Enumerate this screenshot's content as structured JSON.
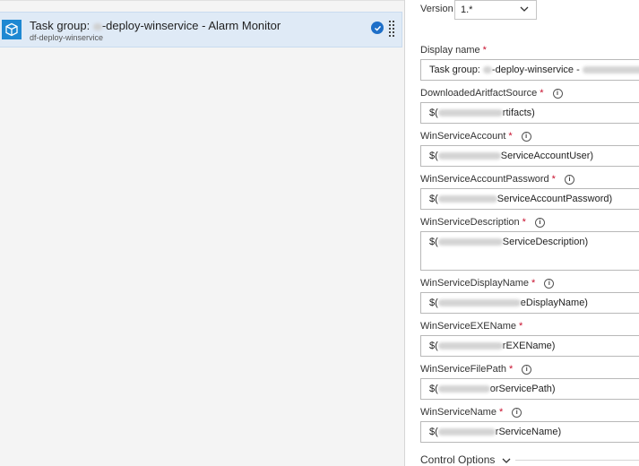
{
  "task_list": {
    "item": {
      "title_prefix": "Task group: ",
      "title_suffix": "-deploy-winservice - Alarm Monitor",
      "subtitle": "df-deploy-winservice"
    }
  },
  "properties": {
    "version_label": "Version",
    "version_value": "1.*",
    "fields": [
      {
        "label": "Display name",
        "required": true,
        "info": false,
        "prefix": "Task group: ",
        "suffix": "-deploy-winservice - "
      },
      {
        "label": "DownloadedAritfactSource",
        "required": true,
        "info": true,
        "prefix": "$(",
        "suffix": "rtifacts)"
      },
      {
        "label": "WinServiceAccount",
        "required": true,
        "info": true,
        "prefix": "$(",
        "suffix": "ServiceAccountUser)"
      },
      {
        "label": "WinServiceAccountPassword",
        "required": true,
        "info": true,
        "prefix": "$(",
        "suffix": "ServiceAccountPassword)"
      },
      {
        "label": "WinServiceDescription",
        "required": true,
        "info": true,
        "prefix": "$(",
        "suffix": "ServiceDescription)"
      },
      {
        "label": "WinServiceDisplayName",
        "required": true,
        "info": true,
        "prefix": "$(",
        "suffix": "eDisplayName)"
      },
      {
        "label": "WinServiceEXEName",
        "required": true,
        "info": false,
        "prefix": "$(",
        "suffix": "rEXEName)"
      },
      {
        "label": "WinServiceFilePath",
        "required": true,
        "info": true,
        "prefix": "$(",
        "suffix": "orServicePath)"
      },
      {
        "label": "WinServiceName",
        "required": true,
        "info": true,
        "prefix": "$(",
        "suffix": "rServiceName)"
      }
    ],
    "required_marker": "*",
    "info_glyph": "i",
    "control_options_label": "Control Options"
  },
  "colors": {
    "accent": "#1e88d2",
    "selected_bg": "#dfeaf6",
    "required": "#c8102e"
  }
}
